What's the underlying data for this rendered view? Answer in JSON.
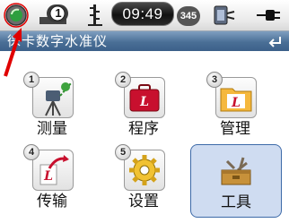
{
  "statusbar": {
    "clock": "09:49",
    "measure_count": "1",
    "side_indicator": "345",
    "icons": [
      "laser-signal-icon",
      "measure-mode-icon",
      "staff-icon",
      "battery-icon",
      "power-plug-icon"
    ]
  },
  "title": "徕卡数字水准仪",
  "menu": [
    {
      "number": "1",
      "label": "测量",
      "icon": "survey-icon"
    },
    {
      "number": "2",
      "label": "程序",
      "icon": "program-case-icon"
    },
    {
      "number": "3",
      "label": "管理",
      "icon": "folder-manage-icon"
    },
    {
      "number": "4",
      "label": "传输",
      "icon": "transfer-icon"
    },
    {
      "number": "5",
      "label": "设置",
      "icon": "settings-gear-icon"
    },
    {
      "number": "",
      "label": "工具",
      "icon": "toolbox-icon",
      "selected": true
    }
  ],
  "colors": {
    "titlebar": "#4a6f96",
    "selection": "#cfdcf1",
    "leica_red": "#c8102e",
    "annotation": "#e00000"
  }
}
